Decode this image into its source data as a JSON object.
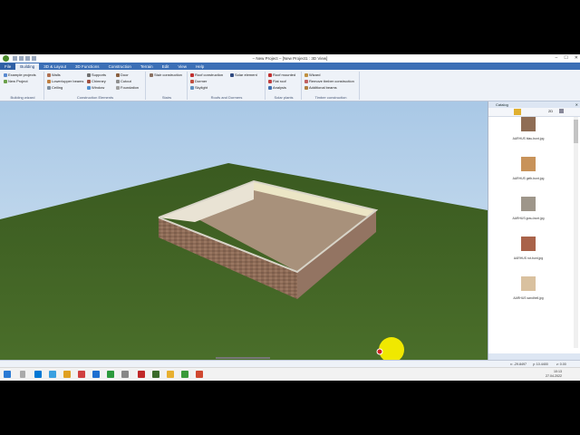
{
  "window": {
    "title": "– New Project – [New Project1 : 3D View]",
    "controls": [
      "–",
      "☐",
      "✕"
    ]
  },
  "ribbon": {
    "tabs": [
      "File",
      "Building",
      "3D & Layout",
      "3D Functions",
      "Construction",
      "Terrain",
      "Edit",
      "View",
      "Help"
    ],
    "active_tab": "Building",
    "groups": {
      "wizard": {
        "label": "Building wizard",
        "items": [
          "Example projects",
          "New Project"
        ]
      },
      "elements": {
        "label": "Construction Elements",
        "items": [
          "Walls",
          "Lower/upper beams",
          "Ceiling",
          "Supports",
          "Chimney",
          "Window",
          "Door",
          "Cutout",
          "Foundation"
        ]
      },
      "stairs": {
        "label": "Stairs",
        "items": [
          "Stair construction"
        ]
      },
      "roofs": {
        "label": "Roofs and Dormers",
        "items": [
          "Roof construction",
          "Dormer",
          "Skylight",
          "Solar element"
        ]
      },
      "solar": {
        "label": "Solar plants",
        "items": [
          "Roof mounted",
          "Flat roof",
          "Analysis"
        ]
      },
      "timber": {
        "label": "Timber construction",
        "items": [
          "Wizard",
          "Remove timber construction",
          "Additional beams"
        ]
      }
    }
  },
  "catalog": {
    "title": "Catalog",
    "items": [
      {
        "name": "AARHUS blau-bunt.jpg",
        "color": "#8f6d55"
      },
      {
        "name": "AARHUS gelb-bunt.jpg",
        "color": "#c8935a"
      },
      {
        "name": "AARHUS grau-bunt.jpg",
        "color": "#9e968a"
      },
      {
        "name": "AARHUS rot-bunt.jpg",
        "color": "#a9634a"
      },
      {
        "name": "AARHUS sandhell.jpg",
        "color": "#d9c19f"
      }
    ]
  },
  "status": {
    "x": "x: -29.8497",
    "y": "y: 10.4400",
    "z": "z: 0.00"
  },
  "taskbar": {
    "time": "10:13",
    "date": "27.04.2022"
  },
  "colors": {
    "ribbon_blue": "#3b6fb6",
    "sky": "#b9d3ea",
    "grass": "#3f5f22",
    "brick": "#8a6a55",
    "floor": "#a8917b",
    "highlight": "#f0e800"
  }
}
